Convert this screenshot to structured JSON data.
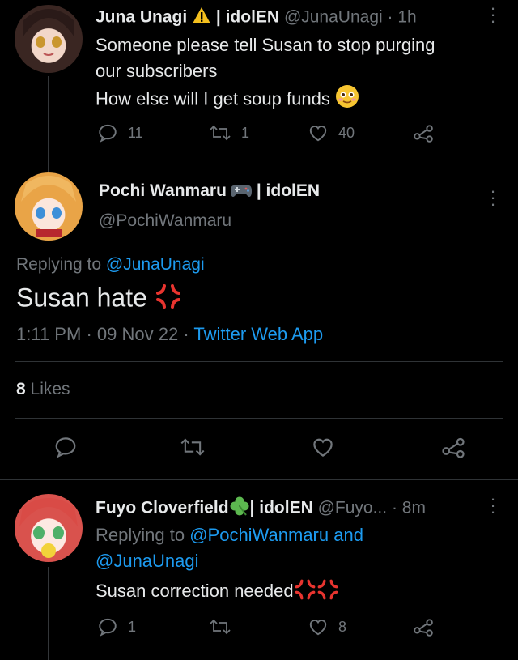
{
  "tweet1": {
    "display_name": "Juna Unagi",
    "name_suffix": "| idolEN",
    "handle": "@JunaUnagi",
    "time": "· 1h",
    "text_lines": [
      "Someone please tell Susan to stop purging",
      "our subscribers",
      "How else will I get soup funds"
    ],
    "reply_count": "11",
    "retweet_count": "1",
    "like_count": "40"
  },
  "tweet2": {
    "display_name": "Pochi Wanmaru",
    "name_suffix": "| idolEN",
    "handle": "@PochiWanmaru",
    "replying_to_label": "Replying to",
    "replying_to_handle": "@JunaUnagi",
    "text": "Susan hate",
    "time": "1:11 PM",
    "date": "09 Nov 22",
    "source": "Twitter Web App",
    "likes_count": "8",
    "likes_label": "Likes"
  },
  "tweet3": {
    "display_name": "Fuyo Cloverfield",
    "name_suffix": "| idolEN",
    "handle": "@Fuyo...",
    "time": "· 8m",
    "replying_to_label": "Replying to",
    "replying_to_handles": "@PochiWanmaru and",
    "replying_to_handles_2": "@JunaUnagi",
    "text": "Susan correction needed",
    "reply_count": "1",
    "like_count": "8"
  },
  "colors": {
    "background": "#000000",
    "text": "#e7e9ea",
    "muted": "#71767b",
    "link": "#1d9bf0",
    "divider": "#2f3336"
  },
  "icons": [
    "warning-icon",
    "controller-icon",
    "clover-icon",
    "smiling-emoji",
    "anger-icon",
    "reply-icon",
    "retweet-icon",
    "like-icon",
    "share-icon",
    "more-icon"
  ]
}
